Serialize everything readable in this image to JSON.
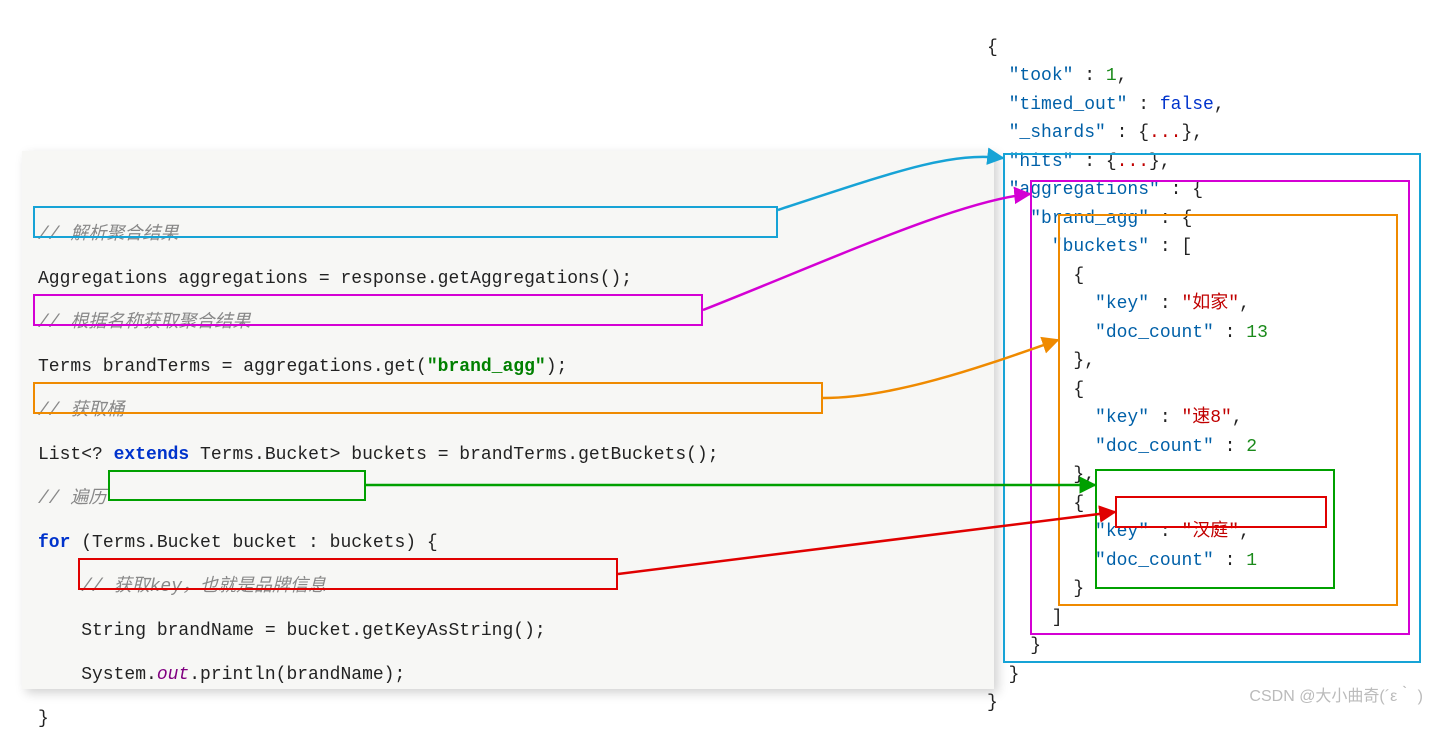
{
  "left": {
    "comment1": "// 解析聚合结果",
    "line1": {
      "a": "Aggregations aggregations = response.getAggregations();"
    },
    "comment2": "// 根据名称获取聚合结果",
    "line2": {
      "a": "Terms brandTerms = aggregations.get(",
      "str": "\"brand_agg\"",
      "b": ");"
    },
    "comment3": "// 获取桶",
    "line3": {
      "a": "List<? ",
      "kw": "extends",
      "b": " Terms.Bucket> buckets = brandTerms.getBuckets();"
    },
    "comment4": "// 遍历",
    "line4": {
      "kw": "for",
      "a": " (",
      "b": "Terms.Bucket bucket",
      "c": " : buckets) {"
    },
    "comment5": "    // 获取key，也就是品牌信息",
    "line5": {
      "a": "    String brandName = bucket.getKeyAsString();"
    },
    "line6": {
      "a": "    System.",
      "out": "out",
      "b": ".println(brandName);"
    },
    "line7": "}"
  },
  "json": {
    "open": "{",
    "took_k": "\"took\"",
    "took_v": "1",
    "timed_k": "\"timed_out\"",
    "timed_v": "false",
    "shards_k": "\"_shards\"",
    "hits_k": "\"hits\"",
    "dots": "...",
    "agg_k": "\"aggregations\"",
    "brand_k": "\"brand_agg\"",
    "buckets_k": "\"buckets\"",
    "key_k": "\"key\"",
    "doc_k": "\"doc_count\"",
    "b1_key": "\"如家\"",
    "b1_cnt": "13",
    "b2_key": "\"速8\"",
    "b2_cnt": "2",
    "b3_key": "\"汉庭\"",
    "b3_cnt": "1",
    "close": "}"
  },
  "watermark": "CSDN @大小曲奇(´ε｀ )"
}
